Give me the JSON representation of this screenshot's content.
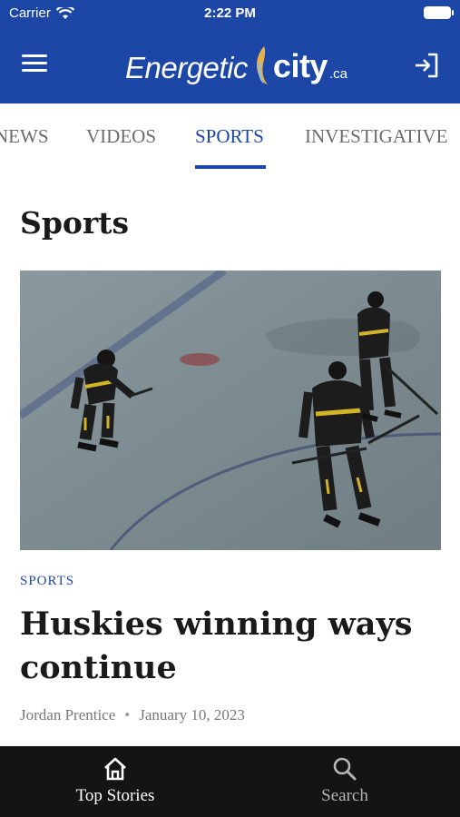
{
  "status_bar": {
    "carrier": "Carrier",
    "time": "2:22 PM"
  },
  "header": {
    "logo": {
      "word1": "Energetic",
      "word2": "city",
      "tld": ".ca"
    },
    "menu_icon": "hamburger-menu-icon",
    "login_icon": "sign-in-icon"
  },
  "tabs": [
    {
      "label": "NEWS",
      "active": false
    },
    {
      "label": "VIDEOS",
      "active": false
    },
    {
      "label": "SPORTS",
      "active": true
    },
    {
      "label": "INVESTIGATIVE",
      "active": false
    }
  ],
  "page": {
    "title": "Sports"
  },
  "article": {
    "category": "SPORTS",
    "headline": "Huskies winning ways continue",
    "author": "Jordan Prentice",
    "separator": "•",
    "date": "January 10, 2023"
  },
  "bottom_nav": [
    {
      "label": "Top Stories",
      "icon": "home-icon",
      "active": true
    },
    {
      "label": "Search",
      "icon": "search-icon",
      "active": false
    }
  ],
  "colors": {
    "brand": "#1c47a6",
    "nav_bg": "#141414",
    "accent_flame": "#e7b24a"
  }
}
